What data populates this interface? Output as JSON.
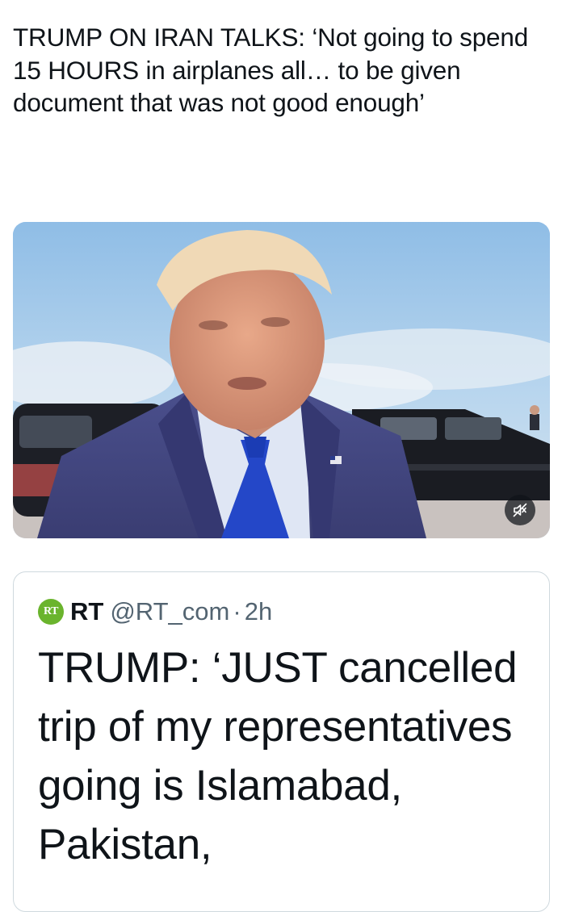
{
  "post": {
    "headline": "TRUMP ON IRAN TALKS: ‘Not going to spend 15 HOURS in airplanes all… to be given document that was not good enough’"
  },
  "media": {
    "type": "video",
    "mute_icon": "speaker-muted-icon"
  },
  "quoted_post": {
    "avatar_text": "RT",
    "author_name": "RT",
    "handle": "@RT_com",
    "separator": "·",
    "time": "2h",
    "text": "TRUMP: ‘JUST cancelled trip of my representatives going is Islamabad, Pakistan,"
  },
  "colors": {
    "text_primary": "#0f1419",
    "text_secondary": "#536471",
    "border": "#cfd9de",
    "rt_brand": "#6ab42d"
  }
}
